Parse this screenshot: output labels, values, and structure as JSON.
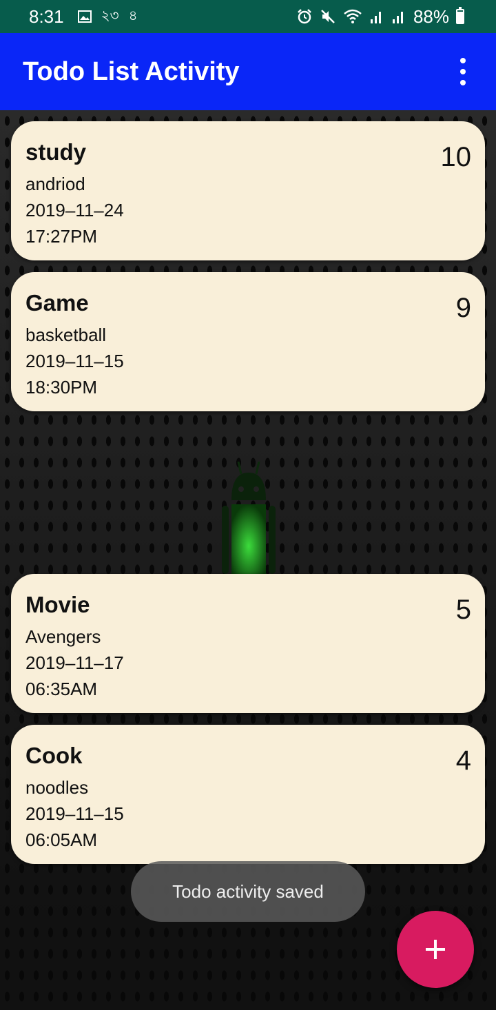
{
  "status_bar": {
    "time": "8:31",
    "left_icons": [
      "image-icon",
      "notification-icon",
      "notification-icon"
    ],
    "left_texts": [
      "২৩",
      "৪"
    ],
    "right_icons": [
      "alarm-icon",
      "mute-icon",
      "wifi-icon",
      "signal-icon",
      "signal-icon",
      "battery-icon"
    ],
    "battery": "88%",
    "battery_level": 0.88
  },
  "appbar": {
    "title": "Todo List Activity",
    "menu_icon": "more-vert-icon",
    "color": "#0a26f7"
  },
  "todos": [
    {
      "title": "study",
      "detail": "andriod",
      "date": "2019–11–24",
      "time": "17:27PM",
      "priority": "10"
    },
    {
      "title": "Game",
      "detail": "basketball",
      "date": "2019–11–15",
      "time": "18:30PM",
      "priority": "9"
    },
    {
      "title": "Movie",
      "detail": "Avengers",
      "date": "2019–11–17",
      "time": "06:35AM",
      "priority": "5"
    },
    {
      "title": "Cook",
      "detail": "noodles",
      "date": "2019–11–15",
      "time": "06:05AM",
      "priority": "4"
    }
  ],
  "toast": {
    "message": "Todo activity saved"
  },
  "fab": {
    "icon": "add-icon",
    "color": "#d81b60"
  }
}
